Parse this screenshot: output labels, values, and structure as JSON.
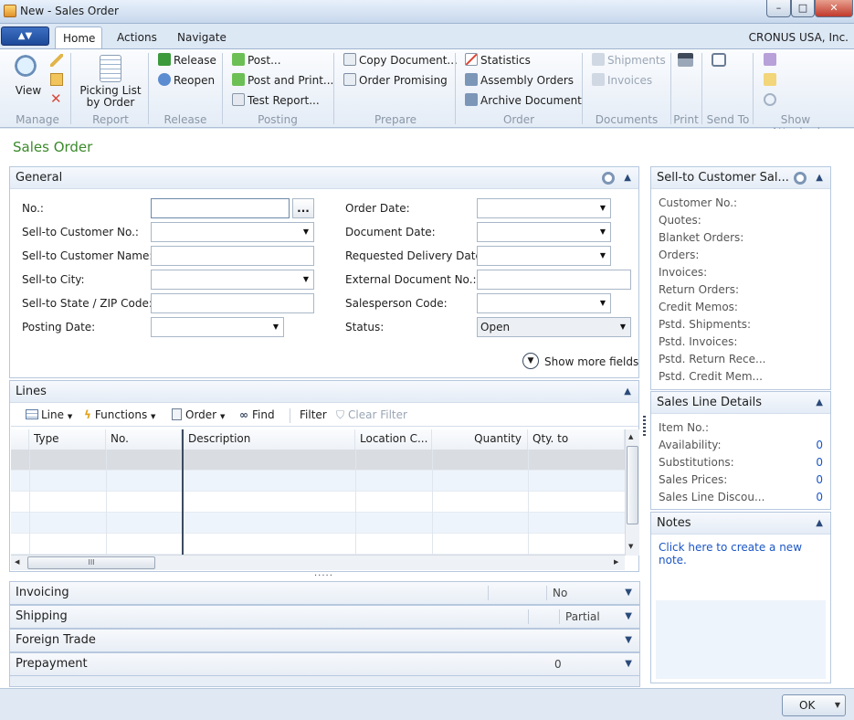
{
  "window": {
    "title": "New - Sales Order",
    "minimize": "–",
    "maximize": "□",
    "close": "✕"
  },
  "ribbon": {
    "app_menu": "▲▼",
    "tabs": [
      "Home",
      "Actions",
      "Navigate"
    ],
    "company": "CRONUS USA, Inc.",
    "groups": {
      "manage": {
        "label": "Manage",
        "view": "View"
      },
      "report": {
        "label": "Report",
        "picking_list_1": "Picking List",
        "picking_list_2": "by Order"
      },
      "release": {
        "label": "Release",
        "release": "Release",
        "reopen": "Reopen"
      },
      "posting": {
        "label": "Posting",
        "post": "Post...",
        "post_print": "Post and Print...",
        "test_report": "Test Report..."
      },
      "prepare": {
        "label": "Prepare",
        "copy_document": "Copy Document...",
        "order_promising": "Order Promising"
      },
      "order": {
        "label": "Order",
        "statistics": "Statistics",
        "assembly_orders": "Assembly Orders",
        "archive_document": "Archive Document"
      },
      "documents": {
        "label": "Documents",
        "shipments": "Shipments",
        "invoices": "Invoices"
      },
      "print": {
        "label": "Print"
      },
      "send_to": {
        "label": "Send To"
      },
      "show_attached": {
        "label": "Show Attached"
      }
    }
  },
  "page": {
    "title": "Sales Order"
  },
  "general": {
    "header": "General",
    "fields": {
      "no": {
        "label": "No.:",
        "value": ""
      },
      "lookup": "...",
      "sell_to_customer_no": {
        "label": "Sell-to Customer No.:",
        "value": ""
      },
      "sell_to_customer_name": {
        "label": "Sell-to Customer Name:",
        "value": ""
      },
      "sell_to_city": {
        "label": "Sell-to City:",
        "value": ""
      },
      "sell_to_state_zip": {
        "label": "Sell-to State / ZIP Code:",
        "value": ""
      },
      "posting_date": {
        "label": "Posting Date:",
        "value": ""
      },
      "order_date": {
        "label": "Order Date:",
        "value": ""
      },
      "document_date": {
        "label": "Document Date:",
        "value": ""
      },
      "requested_delivery_date": {
        "label": "Requested Delivery Date:",
        "value": ""
      },
      "external_document_no": {
        "label": "External Document No.:",
        "value": ""
      },
      "salesperson_code": {
        "label": "Salesperson Code:",
        "value": ""
      },
      "status": {
        "label": "Status:",
        "value": "Open"
      }
    },
    "show_more": "Show more fields"
  },
  "lines": {
    "header": "Lines",
    "toolbar": {
      "line": "Line",
      "functions": "Functions",
      "order": "Order",
      "find": "Find",
      "filter": "Filter",
      "clear_filter": "Clear Filter"
    },
    "columns": [
      "Type",
      "No.",
      "Description",
      "Location C...",
      "Quantity",
      "Qty. to Assemb..."
    ],
    "scroll_thumb": "III",
    "splitter": "....."
  },
  "fasttabs": {
    "invoicing": {
      "label": "Invoicing",
      "value": "No"
    },
    "shipping": {
      "label": "Shipping",
      "value": "Partial"
    },
    "foreign_trade": {
      "label": "Foreign Trade"
    },
    "prepayment": {
      "label": "Prepayment",
      "value": "0"
    }
  },
  "factbox": {
    "customer": {
      "header": "Sell-to Customer Sal...",
      "items": [
        "Customer No.:",
        "Quotes:",
        "Blanket Orders:",
        "Orders:",
        "Invoices:",
        "Return Orders:",
        "Credit Memos:",
        "Pstd. Shipments:",
        "Pstd. Invoices:",
        "Pstd. Return Rece...",
        "Pstd. Credit Mem..."
      ]
    },
    "line_details": {
      "header": "Sales Line Details",
      "items": [
        {
          "label": "Item No.:",
          "value": ""
        },
        {
          "label": "Availability:",
          "value": "0"
        },
        {
          "label": "Substitutions:",
          "value": "0"
        },
        {
          "label": "Sales Prices:",
          "value": "0"
        },
        {
          "label": "Sales Line Discou...",
          "value": "0"
        }
      ]
    },
    "notes": {
      "header": "Notes",
      "link": "Click here to create a new note."
    }
  },
  "footer": {
    "ok": "OK"
  },
  "colors": {
    "accent_green": "#3a8a2a",
    "link_blue": "#1a56c6",
    "ribbon_blue": "#1d4a99"
  }
}
